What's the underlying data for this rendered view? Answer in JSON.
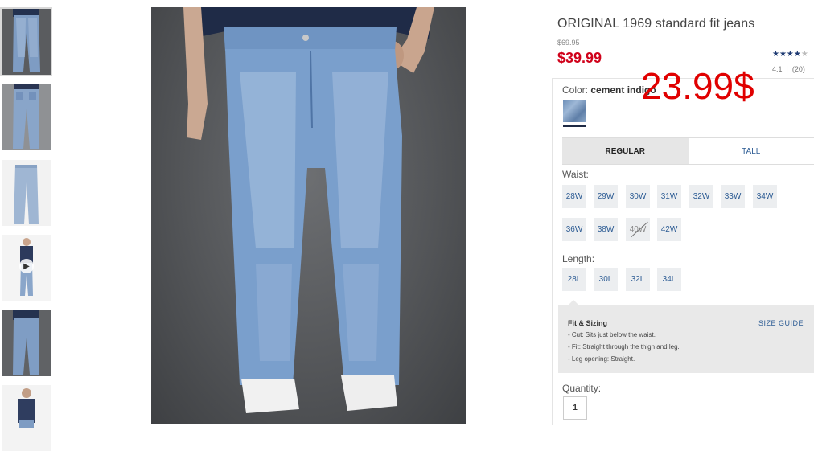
{
  "product": {
    "title": "ORIGINAL 1969 standard fit jeans",
    "old_price": "$69.95",
    "price": "$39.99",
    "overlay_price": "23.99$",
    "rating": {
      "value": "4.1",
      "count": "(20)",
      "stars_filled": "★★★★",
      "stars_empty": "★"
    }
  },
  "color": {
    "label": "Color:",
    "name": "cement indigo"
  },
  "fit_tabs": [
    {
      "label": "REGULAR",
      "active": true
    },
    {
      "label": "TALL",
      "active": false
    }
  ],
  "waist": {
    "label": "Waist:",
    "sizes": [
      "28W",
      "29W",
      "30W",
      "31W",
      "32W",
      "33W",
      "34W",
      "36W",
      "38W",
      "40W",
      "42W"
    ],
    "unavailable": [
      "40W"
    ]
  },
  "length": {
    "label": "Length:",
    "sizes": [
      "28L",
      "30L",
      "32L",
      "34L"
    ]
  },
  "fit_sizing": {
    "title": "Fit & Sizing",
    "size_guide": "SIZE GUIDE",
    "lines": [
      "- Cut: Sits just below the waist.",
      "- Fit: Straight through the thigh and leg.",
      "- Leg opening: Straight."
    ]
  },
  "quantity": {
    "label": "Quantity:",
    "value": "1"
  },
  "icons": {
    "video_thumb": "play-icon",
    "rating": "star-icon"
  },
  "colors": {
    "price_red": "#d0021b",
    "link_blue": "#2d5c94",
    "overlay_red": "#e00000"
  }
}
